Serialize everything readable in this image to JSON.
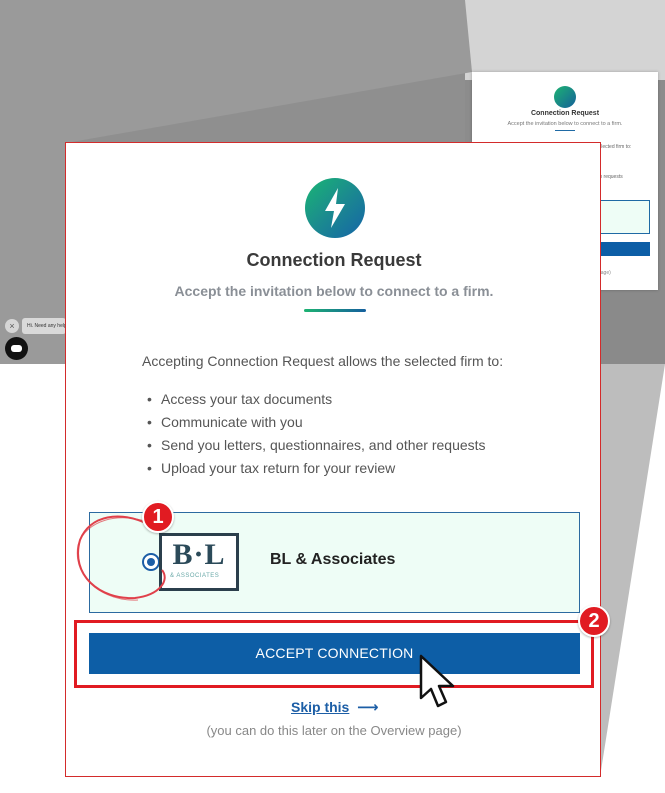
{
  "background": {
    "mini_window": {
      "title": "Connection Request",
      "subtitle": "Accept the invitation below to connect to a firm.",
      "text_1": "selected firm to:",
      "text_2": "m requests",
      "note": "page)"
    },
    "chat": {
      "close_label": "×",
      "bubble_text": "Hi. Need any help"
    }
  },
  "modal": {
    "title": "Connection Request",
    "subtitle": "Accept the invitation below to connect to a firm.",
    "intro": "Accepting Connection Request allows the selected firm to:",
    "permissions": [
      "Access your tax documents",
      "Communicate with you",
      "Send you letters, questionnaires, and other requests",
      "Upload your tax return for your review"
    ],
    "firm": {
      "name": "BL & Associates",
      "logo_letters": "B·L",
      "logo_sub": "& ASSOCIATES",
      "selected": true
    },
    "accept_button": "ACCEPT CONNECTION",
    "skip_link": "Skip this",
    "skip_arrow": "⟶",
    "skip_note": "(you can do this later on the Overview page)"
  },
  "annotations": {
    "badge_1": "1",
    "badge_2": "2",
    "accent_color": "#e11b22"
  },
  "colors": {
    "primary": "#0d5ea6",
    "card_bg": "#eefdf6",
    "logo_gradient_start": "#1ab673",
    "logo_gradient_end": "#1564a8"
  },
  "icons": {
    "logo": "lightning-bolt-icon",
    "cursor": "mouse-pointer-icon",
    "chat": "chat-bubble-icon"
  }
}
